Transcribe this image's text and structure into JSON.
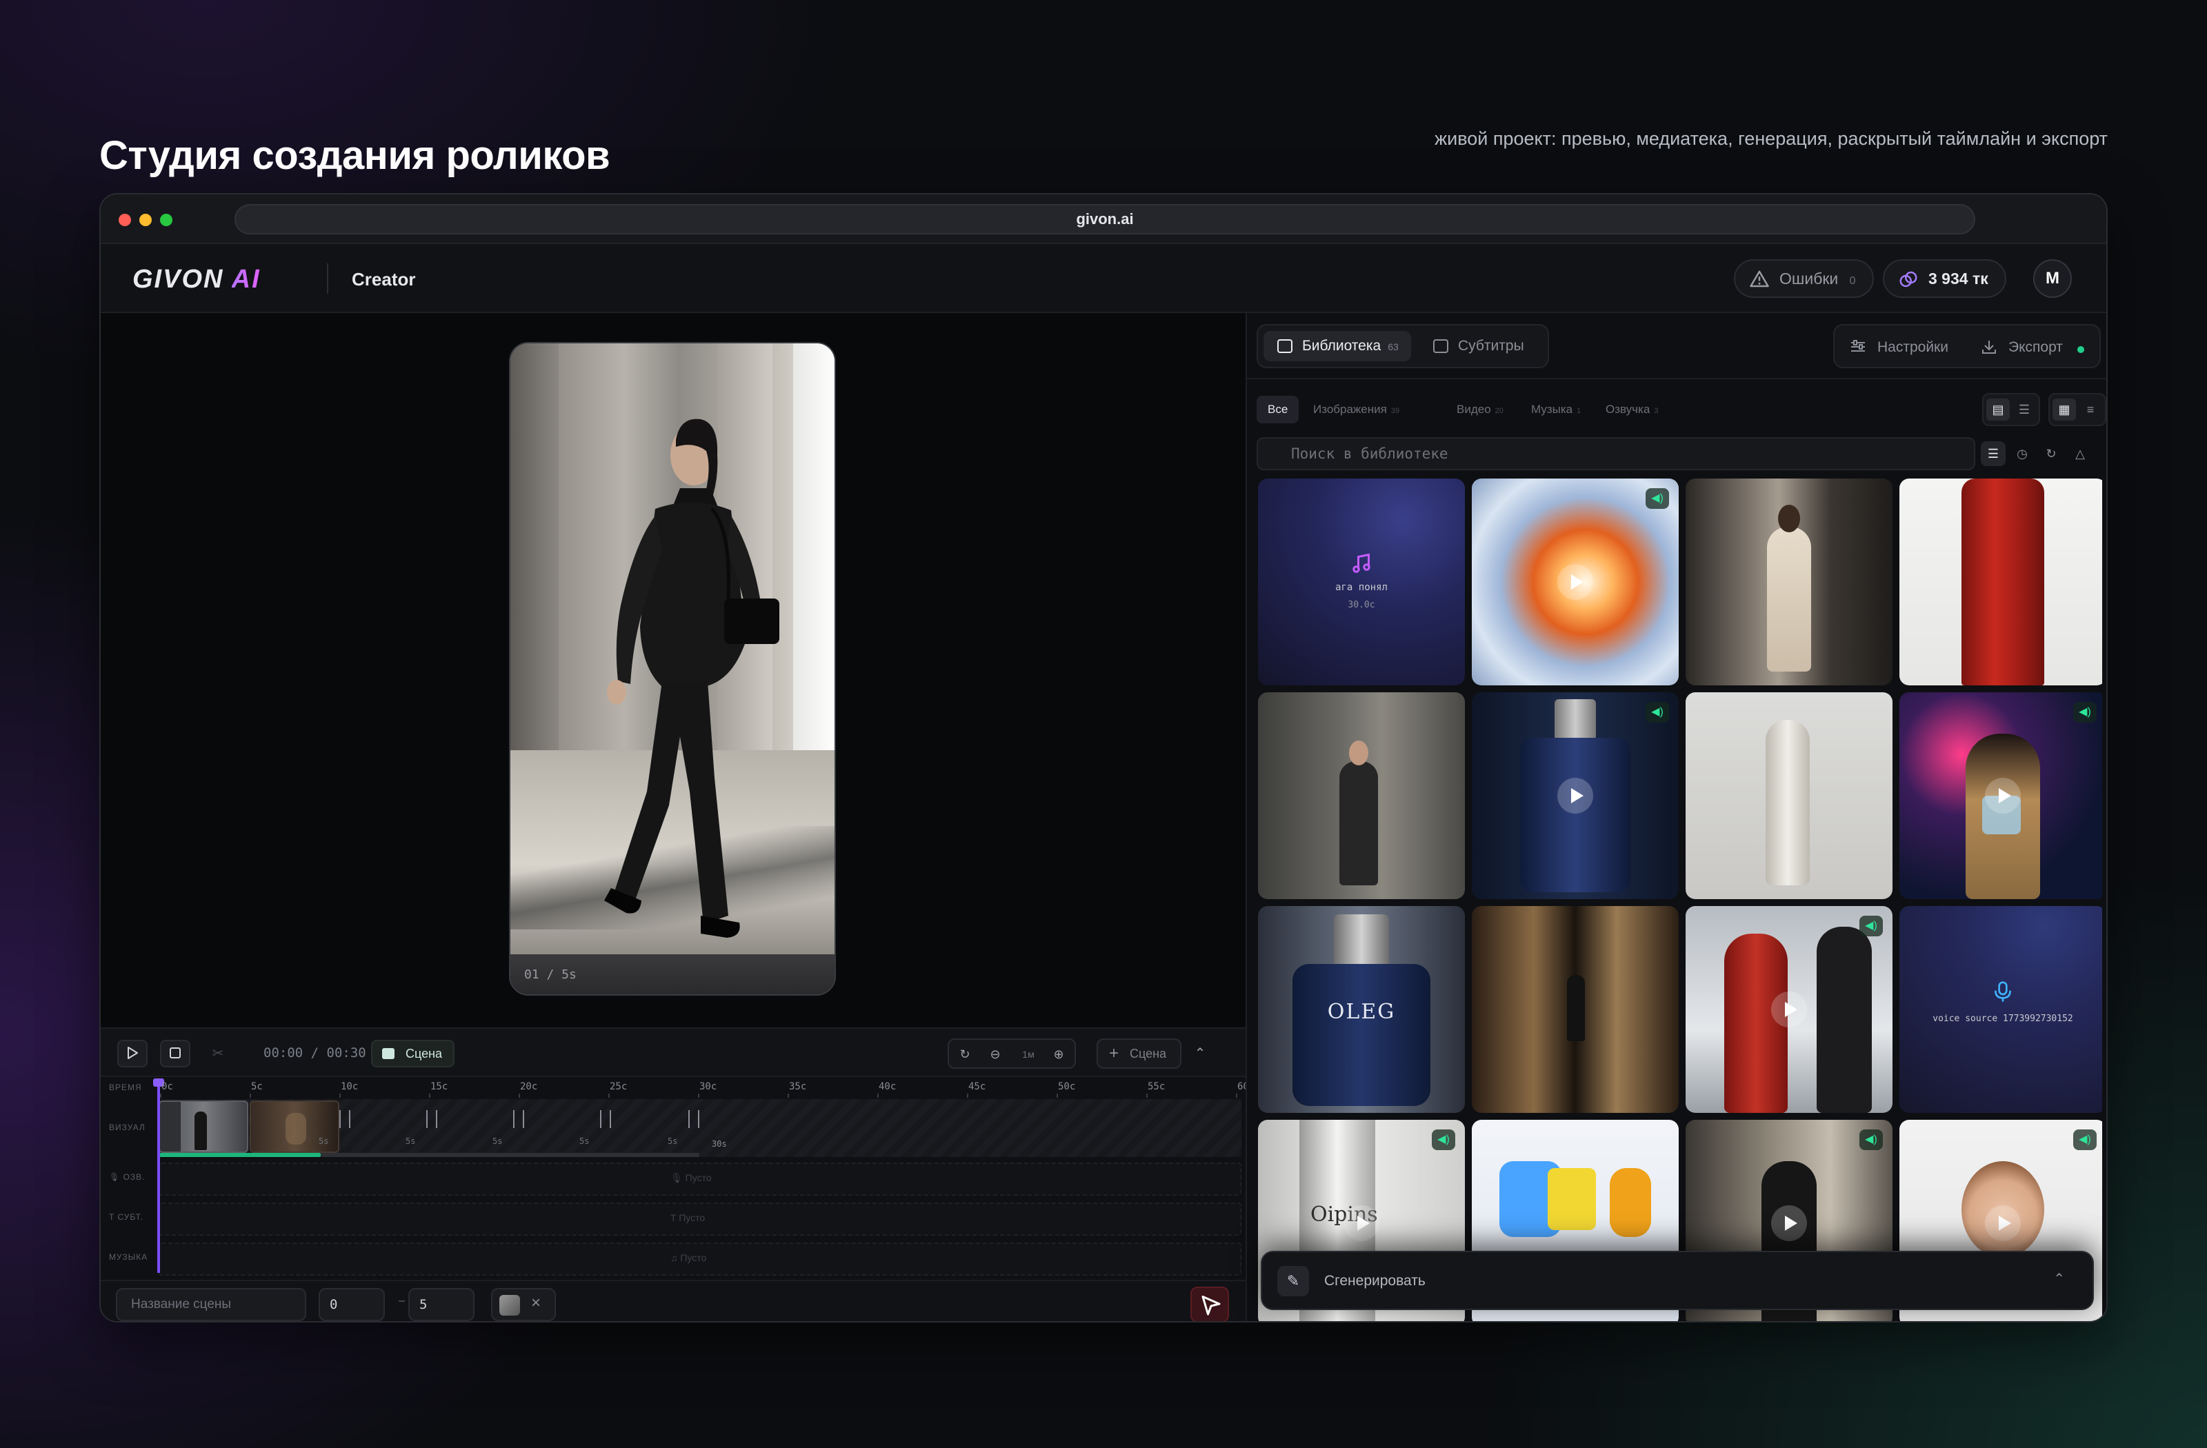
{
  "page": {
    "title": "Студия создания роликов",
    "subtitle": "живой проект: превью, медиатека, генерация, раскрытый таймлайн и экспорт"
  },
  "browser": {
    "url": "givon.ai"
  },
  "app": {
    "logo_main": "GIVON",
    "logo_ai": "AI",
    "name": "Creator",
    "errors_label": "Ошибки",
    "errors_count": "0",
    "tokens": "3 934 тк",
    "avatar_initial": "M"
  },
  "preview": {
    "frame_time": "01 / 5s"
  },
  "timeline": {
    "time": "00:00 / 00:30",
    "scene_chip": "Сцена",
    "zoom_level": "1м",
    "add_scene": "Сцена",
    "ruler_ticks": [
      "0с",
      "5с",
      "10с",
      "15с",
      "20с",
      "25с",
      "30с",
      "35с",
      "40с",
      "45с",
      "50с",
      "55с",
      "60с"
    ],
    "tracks": {
      "time": "ВРЕМЯ",
      "visual": "ВИЗУАЛ",
      "voice": "ОЗВ.",
      "subs": "СУБТ.",
      "music": "МУЗЫКА"
    },
    "clip_lengths": [
      "5s",
      "5s",
      "5s",
      "5s",
      "5s"
    ],
    "end_label": "30s",
    "empty_label": "Пусто",
    "scene_name_placeholder": "Название сцены",
    "start_value": "0",
    "end_value": "5",
    "range_dash": "–",
    "remove_glyph": "×",
    "progress_filled": 0.3
  },
  "library": {
    "tabs": [
      {
        "label": "Библиотека",
        "count": "63",
        "active": true
      },
      {
        "label": "Субтитры",
        "count": "",
        "active": false
      }
    ],
    "settings_label": "Настройки",
    "export_label": "Экспорт",
    "filters": [
      {
        "label": "Все",
        "count": "",
        "active": true
      },
      {
        "label": "Изображения",
        "count": "39",
        "active": false
      },
      {
        "label": "Видео",
        "count": "20",
        "active": false
      },
      {
        "label": "Музыка",
        "count": "1",
        "active": false
      },
      {
        "label": "Озвучка",
        "count": "3",
        "active": false
      }
    ],
    "search_placeholder": "Поиск в библиотеке",
    "tiles": [
      {
        "kind": "audio",
        "title": "ага понял",
        "duration": "30.0с"
      },
      {
        "kind": "video",
        "title": "crystal explosion",
        "sound": true
      },
      {
        "kind": "image",
        "title": "woman beige suit"
      },
      {
        "kind": "image",
        "title": "red leather coat"
      },
      {
        "kind": "image",
        "title": "woman dark coat"
      },
      {
        "kind": "video",
        "title": "blue perfume bottle",
        "sound": true
      },
      {
        "kind": "image",
        "title": "venus statue"
      },
      {
        "kind": "video",
        "title": "neon girl cube",
        "sound": true
      },
      {
        "kind": "image",
        "title": "OLEG perfume"
      },
      {
        "kind": "image",
        "title": "corridor walk"
      },
      {
        "kind": "video",
        "title": "red coat clouds",
        "sound": true
      },
      {
        "kind": "voice",
        "title": "voice source 1773992730152"
      },
      {
        "kind": "video",
        "title": "oipins bottle",
        "sound": true
      },
      {
        "kind": "image",
        "title": "cartoon battle"
      },
      {
        "kind": "video",
        "title": "dancing woman",
        "sound": true
      },
      {
        "kind": "video",
        "title": "smiling girl",
        "sound": true
      }
    ],
    "perfume_brand": "OLEG",
    "bottle_brand": "Oipins",
    "generate_label": "Сгенерировать"
  }
}
